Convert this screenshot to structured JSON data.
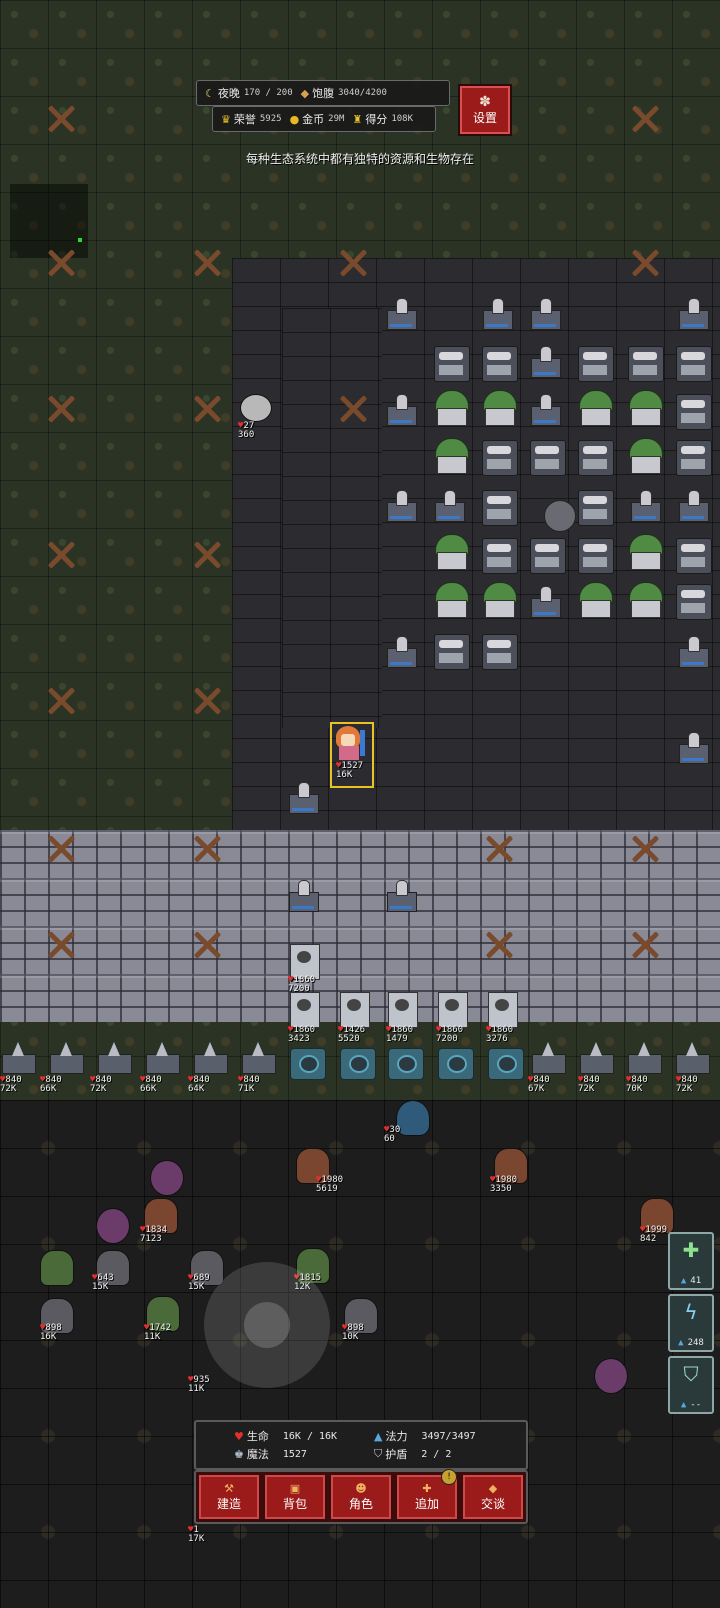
{
  "hud": {
    "night": {
      "label": "夜晚",
      "value": "170 / 200"
    },
    "satiety": {
      "label": "饱腹",
      "value": "3040/4200"
    },
    "honor": {
      "label": "荣誉",
      "value": "5925"
    },
    "gold": {
      "label": "金币",
      "value": "29M"
    },
    "score": {
      "label": "得分",
      "value": "108K"
    },
    "settings_label": "设置"
  },
  "tip": "每种生态系统中都有独特的资源和生物存在",
  "player": {
    "hp_label": "1527",
    "max_label": "16K"
  },
  "stats": {
    "hp": {
      "label": "生命",
      "value": "16K / 16K"
    },
    "mana": {
      "label": "法力",
      "value": "3497/3497"
    },
    "magic": {
      "label": "魔法",
      "value": "1527"
    },
    "shield": {
      "label": "护盾",
      "value": "2  /  2"
    }
  },
  "actions": [
    {
      "label": "建造"
    },
    {
      "label": "背包"
    },
    {
      "label": "角色"
    },
    {
      "label": "追加",
      "badge": "!"
    },
    {
      "label": "交谈"
    }
  ],
  "skills": [
    {
      "icon": "heal-skill-icon",
      "cost": "41"
    },
    {
      "icon": "lightning-skill-icon",
      "cost": "248"
    },
    {
      "icon": "shield-skill-icon",
      "cost": "--"
    }
  ],
  "unit_labels": {
    "wolf": [
      "27",
      "360"
    ],
    "tower1": [
      "1860",
      "7200"
    ],
    "tower2": [
      "1860",
      "3423"
    ],
    "tower3": [
      "1426",
      "5520"
    ],
    "tower4": [
      "1860",
      "1479"
    ],
    "tower5": [
      "1860",
      "7200"
    ],
    "tower6": [
      "1860",
      "3276"
    ],
    "spike1": [
      "840",
      "72K"
    ],
    "spike2": [
      "840",
      "66K"
    ],
    "spike3": [
      "840",
      "72K"
    ],
    "spike4": [
      "840",
      "66K"
    ],
    "spike5": [
      "840",
      "64K"
    ],
    "spike6": [
      "840",
      "71K"
    ],
    "spike7": [
      "840",
      "67K"
    ],
    "spike8": [
      "840",
      "72K"
    ],
    "spike9": [
      "840",
      "70K"
    ],
    "spike10": [
      "840",
      "72K"
    ],
    "ghost": [
      "30",
      "60"
    ],
    "tree1": [
      "1980",
      "5619"
    ],
    "tree2": [
      "1980",
      "3350"
    ],
    "tree3": [
      "1834",
      "7123"
    ],
    "tree4": [
      "1999",
      "842"
    ],
    "m1": [
      "643",
      "15K"
    ],
    "m2": [
      "689",
      "15K"
    ],
    "m3": [
      "1815",
      "12K"
    ],
    "m4": [
      "898",
      "16K"
    ],
    "m5": [
      "1742",
      "11K"
    ],
    "m6": [
      "898",
      "10K"
    ],
    "m7": [
      "935",
      "11K"
    ],
    "m8": [
      "1",
      "17K"
    ]
  },
  "colors": {
    "accent_red": "#9b1b1b",
    "highlight_gold": "#e8c228",
    "hp_red": "#e03030",
    "mana_blue": "#58a6e0"
  }
}
